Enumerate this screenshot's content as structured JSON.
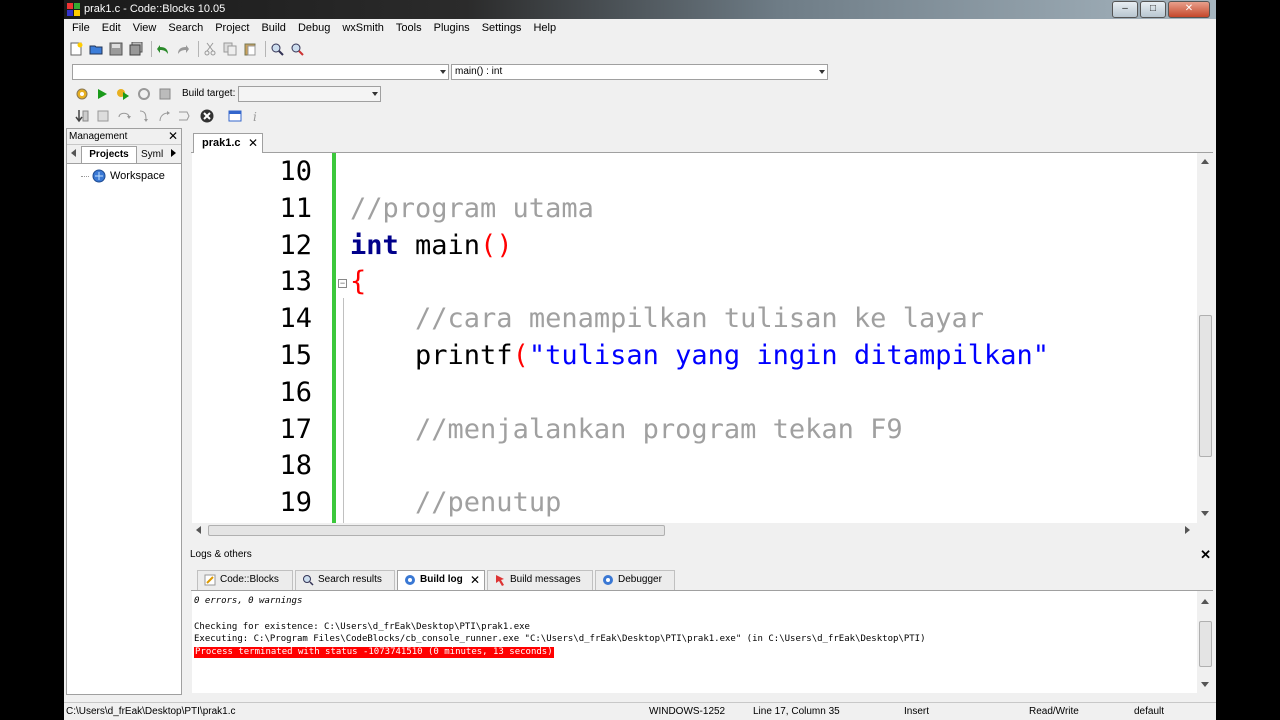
{
  "window": {
    "title": "prak1.c - Code::Blocks 10.05",
    "buttons": {
      "minimize": "–",
      "maximize": "□",
      "close": "✕"
    }
  },
  "menu": [
    "File",
    "Edit",
    "View",
    "Search",
    "Project",
    "Build",
    "Debug",
    "wxSmith",
    "Tools",
    "Plugins",
    "Settings",
    "Help"
  ],
  "toolbar": {
    "scope_combo_value": "",
    "function_combo_value": "main() : int",
    "build_target_label": "Build target:",
    "build_target_value": ""
  },
  "management": {
    "title": "Management",
    "close": "✕",
    "tabs": [
      "Projects",
      "Syml"
    ],
    "workspace_label": "Workspace"
  },
  "editor": {
    "tab_label": "prak1.c",
    "tab_close": "✕",
    "lines": [
      {
        "num": "10",
        "segments": []
      },
      {
        "num": "11",
        "segments": [
          {
            "cls": "cm",
            "text": "//program utama",
            "indent": 0
          }
        ]
      },
      {
        "num": "12",
        "segments": [
          {
            "cls": "kw",
            "text": "int"
          },
          {
            "cls": "",
            "text": " main"
          },
          {
            "cls": "paren",
            "text": "()"
          }
        ]
      },
      {
        "num": "13",
        "segments": [
          {
            "cls": "paren",
            "text": "{"
          }
        ]
      },
      {
        "num": "14",
        "segments": [
          {
            "cls": "",
            "text": "    "
          },
          {
            "cls": "cm",
            "text": "//cara menampilkan tulisan ke layar"
          }
        ]
      },
      {
        "num": "15",
        "segments": [
          {
            "cls": "",
            "text": "    printf"
          },
          {
            "cls": "paren",
            "text": "("
          },
          {
            "cls": "str",
            "text": "\"tulisan yang ingin ditampilkan\""
          }
        ]
      },
      {
        "num": "16",
        "segments": []
      },
      {
        "num": "17",
        "segments": [
          {
            "cls": "",
            "text": "    "
          },
          {
            "cls": "cm",
            "text": "//menjalankan program tekan F9"
          }
        ]
      },
      {
        "num": "18",
        "segments": []
      },
      {
        "num": "19",
        "segments": [
          {
            "cls": "",
            "text": "    "
          },
          {
            "cls": "cm",
            "text": "//penutup"
          }
        ]
      }
    ]
  },
  "logs": {
    "title": "Logs & others",
    "close": "✕",
    "tabs": [
      {
        "label": "Code::Blocks",
        "active": false
      },
      {
        "label": "Search results",
        "active": false
      },
      {
        "label": "Build log",
        "active": true
      },
      {
        "label": "Build messages",
        "active": false
      },
      {
        "label": "Debugger",
        "active": false
      }
    ],
    "tab_close": "✕",
    "lines": [
      {
        "text": "0 errors, 0 warnings",
        "style": "it"
      },
      {
        "text": "",
        "style": ""
      },
      {
        "text": "Checking for existence: C:\\Users\\d_frEak\\Desktop\\PTI\\prak1.exe",
        "style": ""
      },
      {
        "text": "Executing: C:\\Program Files\\CodeBlocks/cb_console_runner.exe \"C:\\Users\\d_frEak\\Desktop\\PTI\\prak1.exe\" (in C:\\Users\\d_frEak\\Desktop\\PTI)",
        "style": ""
      },
      {
        "text": "Process terminated with status -1073741510 (0 minutes, 13 seconds)",
        "style": "err"
      }
    ]
  },
  "status": {
    "path": "C:\\Users\\d_frEak\\Desktop\\PTI\\prak1.c",
    "encoding": "WINDOWS-1252",
    "position": "Line 17, Column 35",
    "mode": "Insert",
    "access": "Read/Write",
    "profile": "default"
  },
  "colors": {
    "comment": "#a0a0a0",
    "keyword": "#00008b",
    "string": "#0000ff",
    "paren": "#ff0000",
    "changebar": "#3cc83c",
    "error_bg": "#ff0000"
  }
}
